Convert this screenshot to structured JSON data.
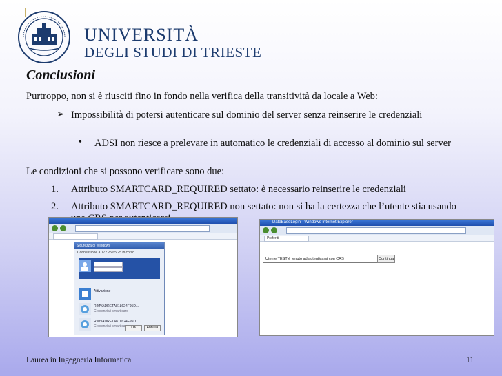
{
  "header": {
    "logo_line1": "UNIVERSITÀ",
    "logo_line2": "DEGLI STUDI DI TRIESTE"
  },
  "slide": {
    "title": "Conclusioni",
    "intro": "Purtroppo, non si è riusciti fino in fondo nella verifica della transitività da locale a Web:",
    "bullet1": "Impossibilità di potersi autenticare sul dominio del server senza reinserire le credenziali",
    "bullet1_marker": "➢",
    "bullet2": "ADSI non riesce a prelevare in automatico le credenziali di accesso al dominio sul server",
    "bullet2_marker": "•",
    "conditions_intro": "Le condizioni che si possono verificare sono due:",
    "conditions": [
      {
        "num": "1.",
        "text": "Attributo SMARTCARD_REQUIRED settato: è necessario reinserire le credenziali"
      },
      {
        "num": "2.",
        "text": "Attributo SMARTCARD_REQUIRED non settato: non si ha la certezza che l’utente stia usando una CRS per autenticarsi"
      }
    ]
  },
  "screenshot_left": {
    "dialog_title": "Sicurezza di Windows",
    "dialog_subtitle": "Connessione a 172.25.65.25 in corso.",
    "credentials": [
      {
        "line1": "Attivazione",
        "line2": ""
      },
      {
        "line1": "RIMVADRETA81L624F95D...",
        "line2": "Credenziali smart card"
      },
      {
        "line1": "RIMVADRETA81L624F95D...",
        "line2": "Credenziali smart card"
      }
    ],
    "ok": "OK",
    "cancel": "Annulla"
  },
  "screenshot_right": {
    "window_title": "DataBaseLogin - Windows Internet Explorer",
    "tab_label": "Preferiti",
    "tab_page": "DataBaseLogin",
    "message": "Utente TEST è tenuto ad autenticarsi con CRS",
    "button": "Continua"
  },
  "footer": {
    "course": "Laurea in Ingegneria Informatica",
    "page_number": "11"
  },
  "colors": {
    "logo_blue": "#1c3b6e",
    "rule_gold": "#c8b36a",
    "bg_top": "#ffffff",
    "bg_bottom": "#a9a9ec"
  }
}
